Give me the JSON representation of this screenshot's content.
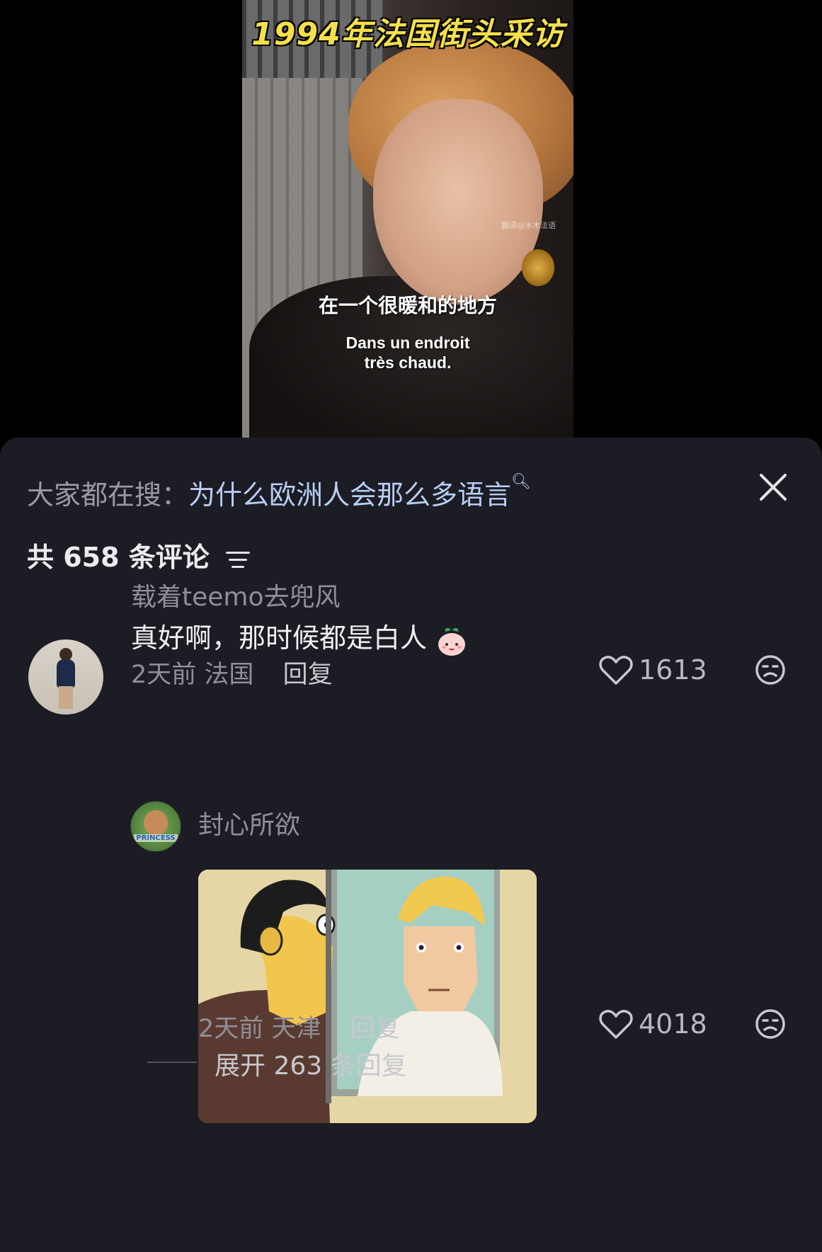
{
  "video": {
    "title": "1994年法国街头采访",
    "watermark": "翻译@水木法语",
    "subtitle_zh": "在一个很暖和的地方",
    "subtitle_fr_line1": "Dans un endroit",
    "subtitle_fr_line2": "très chaud."
  },
  "comments_panel": {
    "search_prefix": "大家都在搜：",
    "search_query": "为什么欧洲人会那么多语言",
    "count_label": "共 658 条评论",
    "comments": [
      {
        "username": "载着teemo去兜风",
        "text": "真好啊，那时候都是白人",
        "time": "2天前",
        "location": "法国",
        "reply_label": "回复",
        "likes": "1613"
      }
    ],
    "replies": [
      {
        "username": "封心所欲",
        "time": "2天前",
        "location": "天津",
        "reply_label": "回复",
        "likes": "4018",
        "avatar_text": "PRINCESS"
      }
    ],
    "expand_label": "展开 263 条回复"
  },
  "icons": {
    "close": "close-icon",
    "filter": "filter-icon",
    "like": "heart-icon",
    "dislike": "unhappy-face-icon",
    "search": "search-icon"
  }
}
